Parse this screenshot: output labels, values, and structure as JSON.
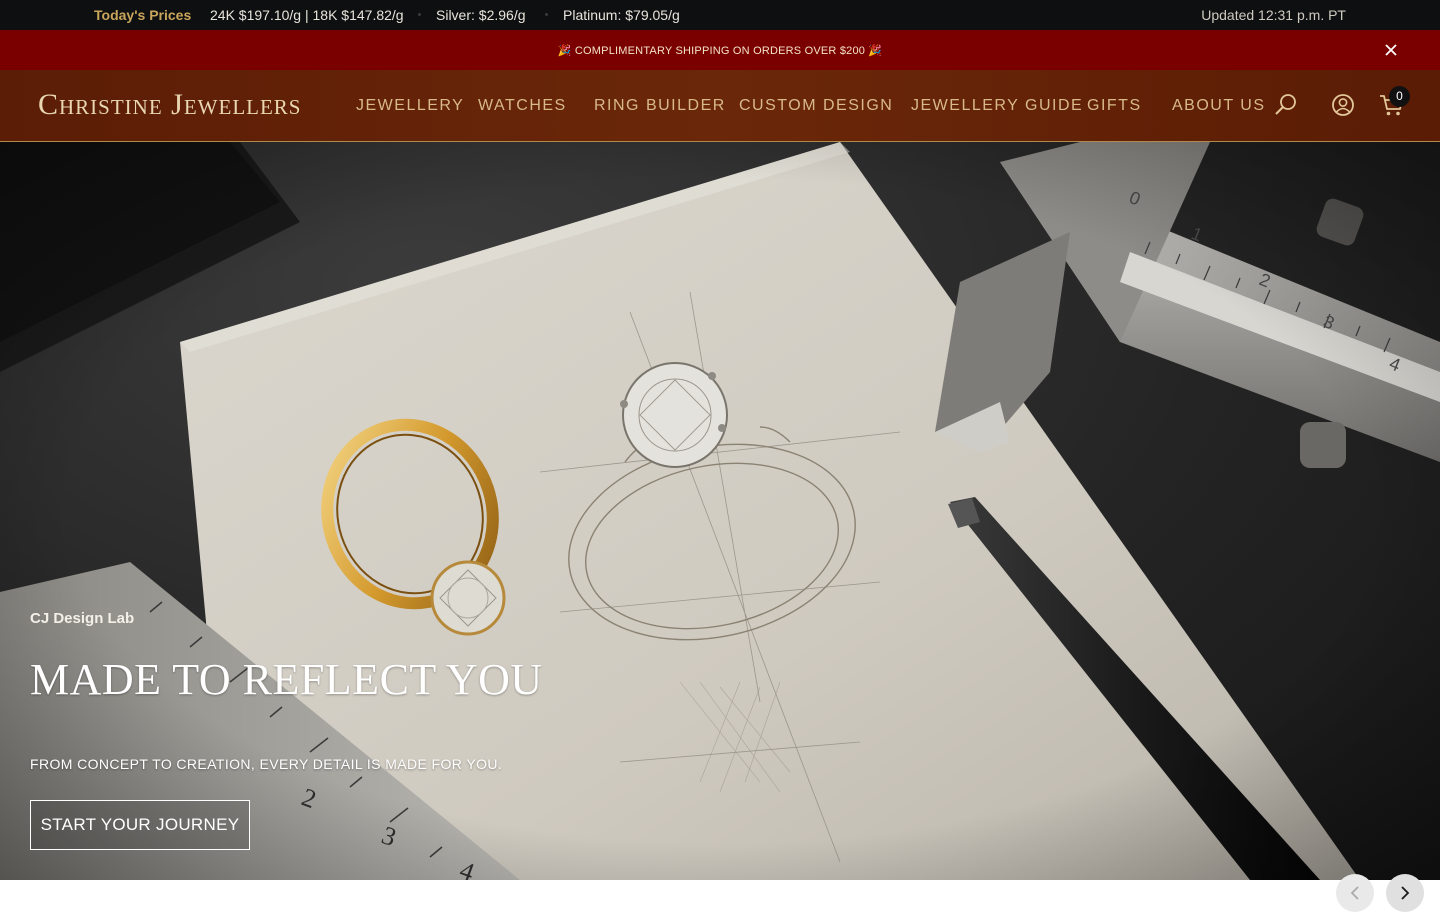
{
  "prices_bar": {
    "label": "Today's Prices",
    "gold": "24K $197.10/g | 18K $147.82/g",
    "silver": "Silver: $2.96/g",
    "platinum": "Platinum: $79.05/g",
    "updated": "Updated 12:31 p.m. PT"
  },
  "promo": {
    "text": "🎉 COMPLIMENTARY SHIPPING ON ORDERS OVER $200 🎉",
    "close_icon": "close-icon"
  },
  "header": {
    "logo": "Christine Jewellers",
    "nav": [
      "JEWELLERY",
      "WATCHES",
      "RING BUILDER",
      "CUSTOM DESIGN",
      "JEWELLERY GUIDE",
      "GIFTS",
      "ABOUT US"
    ],
    "icons": [
      "search-icon",
      "account-icon",
      "cart-icon"
    ],
    "cart_count": "0"
  },
  "hero": {
    "eyebrow": "CJ Design Lab",
    "title": "MADE TO REFLECT YOU",
    "subtitle": "FROM CONCEPT TO CREATION, EVERY DETAIL IS MADE FOR YOU.",
    "cta": "START YOUR JOURNEY"
  },
  "carousel": {
    "icons": [
      "chevron-left-icon",
      "chevron-right-icon"
    ]
  },
  "colors": {
    "top_bar": "#0e0f10",
    "promo_bar": "#7a0000",
    "header": "#6b2709",
    "accent_gold": "#c9a55c"
  }
}
